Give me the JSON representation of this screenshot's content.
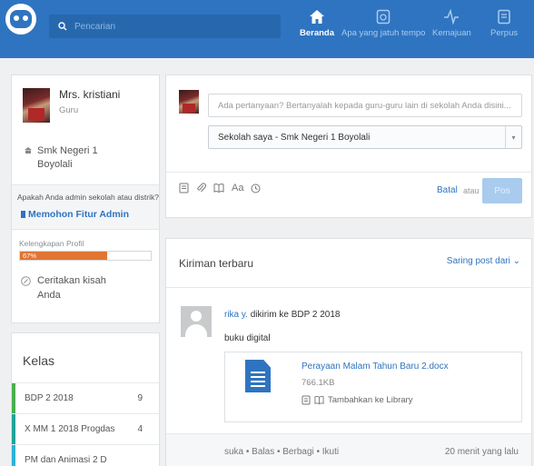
{
  "colors": {
    "brand": "#2f74c0",
    "progress": "#e07534"
  },
  "search": {
    "placeholder": "Pencarian"
  },
  "nav": [
    {
      "label": "Beranda",
      "icon": "home-icon",
      "active": true
    },
    {
      "label": "Apa yang jatuh tempo",
      "icon": "calendar-icon",
      "active": false
    },
    {
      "label": "Kemajuan",
      "icon": "progress-icon",
      "active": false
    },
    {
      "label": "Perpus",
      "icon": "library-icon",
      "active": false
    }
  ],
  "profile": {
    "name": "Mrs. kristiani",
    "role": "Guru",
    "school_line1": "Smk Negeri 1",
    "school_line2": "Boyolali",
    "admin_question": "Apakah Anda admin sekolah atau distrik?",
    "admin_link": "Memohon Fitur Admin",
    "completion_label": "Kelengkapan Profil",
    "completion_percent": 67,
    "completion_text": "67%",
    "story_line1": "Ceritakan kisah",
    "story_line2": "Anda"
  },
  "classes": {
    "title": "Kelas",
    "items": [
      {
        "name": "BDP 2 2018",
        "count": "9",
        "color": "#4cae4f"
      },
      {
        "name": "X MM 1 2018 Progdas",
        "count": "4",
        "color": "#1fa39a"
      },
      {
        "name": "PM dan Animasi 2 D",
        "count": "",
        "color": "#2bb3d6"
      }
    ]
  },
  "composer": {
    "placeholder": "Ada pertanyaan? Bertanyalah kepada guru-guru lain di sekolah Anda disini...",
    "selected_group": "Sekolah saya - Smk Negeri 1 Boyolali",
    "cancel": "Batal",
    "or": "atau",
    "post": "Pos"
  },
  "feed": {
    "title": "Kiriman terbaru",
    "filter": "Saring post dari",
    "post": {
      "author": "rika y.",
      "sent_to": "dikirim ke BDP 2 2018",
      "body": "buku digital",
      "attachment_name": "Perayaan Malam Tahun Baru 2.docx",
      "attachment_size": "766.1KB",
      "add_to_library": "Tambahkan ke Library",
      "actions": "suka  •  Balas  •  Berbagi  •  Ikuti",
      "time": "20 menit yang lalu"
    }
  }
}
